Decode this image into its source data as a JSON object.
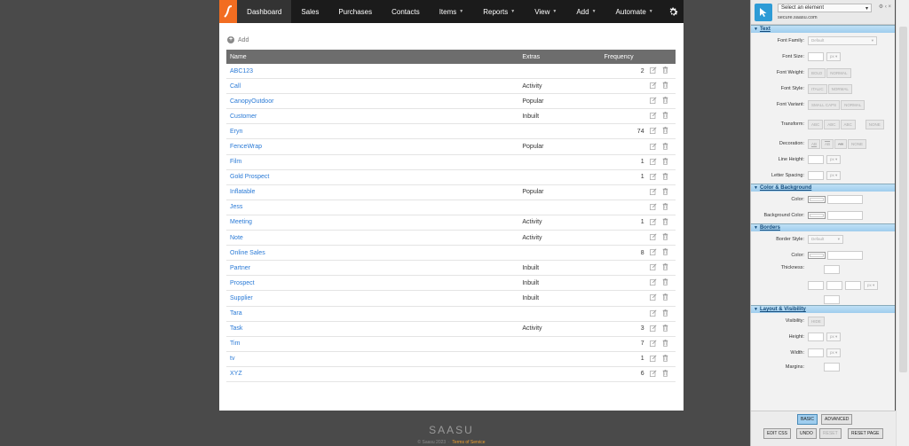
{
  "nav": {
    "items": [
      {
        "label": "Dashboard",
        "active": true,
        "caret": false
      },
      {
        "label": "Sales",
        "active": false,
        "caret": false
      },
      {
        "label": "Purchases",
        "active": false,
        "caret": false
      },
      {
        "label": "Contacts",
        "active": false,
        "caret": false
      },
      {
        "label": "Items",
        "active": false,
        "caret": true
      },
      {
        "label": "Reports",
        "active": false,
        "caret": true
      },
      {
        "label": "View",
        "active": false,
        "caret": true
      },
      {
        "label": "Add",
        "active": false,
        "caret": true
      },
      {
        "label": "Automate",
        "active": false,
        "caret": true
      }
    ],
    "logo_color": "#f26d21"
  },
  "main": {
    "add_label": "Add",
    "columns": {
      "name": "Name",
      "extras": "Extras",
      "frequency": "Frequency"
    },
    "rows": [
      {
        "name": "ABC123",
        "extras": "",
        "frequency": "2"
      },
      {
        "name": "Call",
        "extras": "Activity",
        "frequency": ""
      },
      {
        "name": "CanopyOutdoor",
        "extras": "Popular",
        "frequency": ""
      },
      {
        "name": "Customer",
        "extras": "Inbuilt",
        "frequency": ""
      },
      {
        "name": "Eryn",
        "extras": "",
        "frequency": "74"
      },
      {
        "name": "FenceWrap",
        "extras": "Popular",
        "frequency": ""
      },
      {
        "name": "Film",
        "extras": "",
        "frequency": "1"
      },
      {
        "name": "Gold Prospect",
        "extras": "",
        "frequency": "1"
      },
      {
        "name": "Inflatable",
        "extras": "Popular",
        "frequency": ""
      },
      {
        "name": "Jess",
        "extras": "",
        "frequency": ""
      },
      {
        "name": "Meeting",
        "extras": "Activity",
        "frequency": "1"
      },
      {
        "name": "Note",
        "extras": "Activity",
        "frequency": ""
      },
      {
        "name": "Online Sales",
        "extras": "",
        "frequency": "8"
      },
      {
        "name": "Partner",
        "extras": "Inbuilt",
        "frequency": ""
      },
      {
        "name": "Prospect",
        "extras": "Inbuilt",
        "frequency": ""
      },
      {
        "name": "Supplier",
        "extras": "Inbuilt",
        "frequency": ""
      },
      {
        "name": "Tara",
        "extras": "",
        "frequency": ""
      },
      {
        "name": "Task",
        "extras": "Activity",
        "frequency": "3"
      },
      {
        "name": "Tim",
        "extras": "",
        "frequency": "7"
      },
      {
        "name": "tv",
        "extras": "",
        "frequency": "1"
      },
      {
        "name": "XYZ",
        "extras": "",
        "frequency": "6"
      }
    ]
  },
  "footer": {
    "brand": "SAASU",
    "copyright": "© Saasu 2023",
    "terms": "Terms of Service"
  },
  "panel": {
    "select_placeholder": "Select an element",
    "host": "secure.saasu.com",
    "sections": {
      "text": "Text",
      "color_bg": "Color & Background",
      "borders": "Borders",
      "layout": "Layout & Visibility"
    },
    "labels": {
      "font_family": "Font Family:",
      "font_size": "Font Size:",
      "font_weight": "Font Weight:",
      "font_style": "Font Style:",
      "font_variant": "Font Variant:",
      "transform": "Transform:",
      "decoration": "Decoration:",
      "line_height": "Line Height:",
      "letter_spacing": "Letter Spacing:",
      "color": "Color:",
      "background_color": "Background Color:",
      "border_style": "Border Style:",
      "border_color": "Color:",
      "thickness": "Thickness:",
      "visibility": "Visibility:",
      "height": "Height:",
      "width": "Width:",
      "margins": "Margins:"
    },
    "values": {
      "default": "Default",
      "px": "px",
      "bold": "BOLD",
      "normal": "NORMAL",
      "italic": "ITALIC",
      "small_caps": "SMALL CAPS",
      "abc1": "ABC",
      "abc2": "ABC",
      "abc3": "ABC",
      "none": "NONE",
      "ab1": "AB",
      "ab2": "AB",
      "ab3": "AB",
      "hide": "HIDE"
    },
    "buttons": {
      "basic": "BASIC",
      "advanced": "ADVANCED",
      "edit_css": "EDIT CSS",
      "undo": "UNDO",
      "reset": "RESET",
      "reset_page": "RESET PAGE"
    }
  }
}
